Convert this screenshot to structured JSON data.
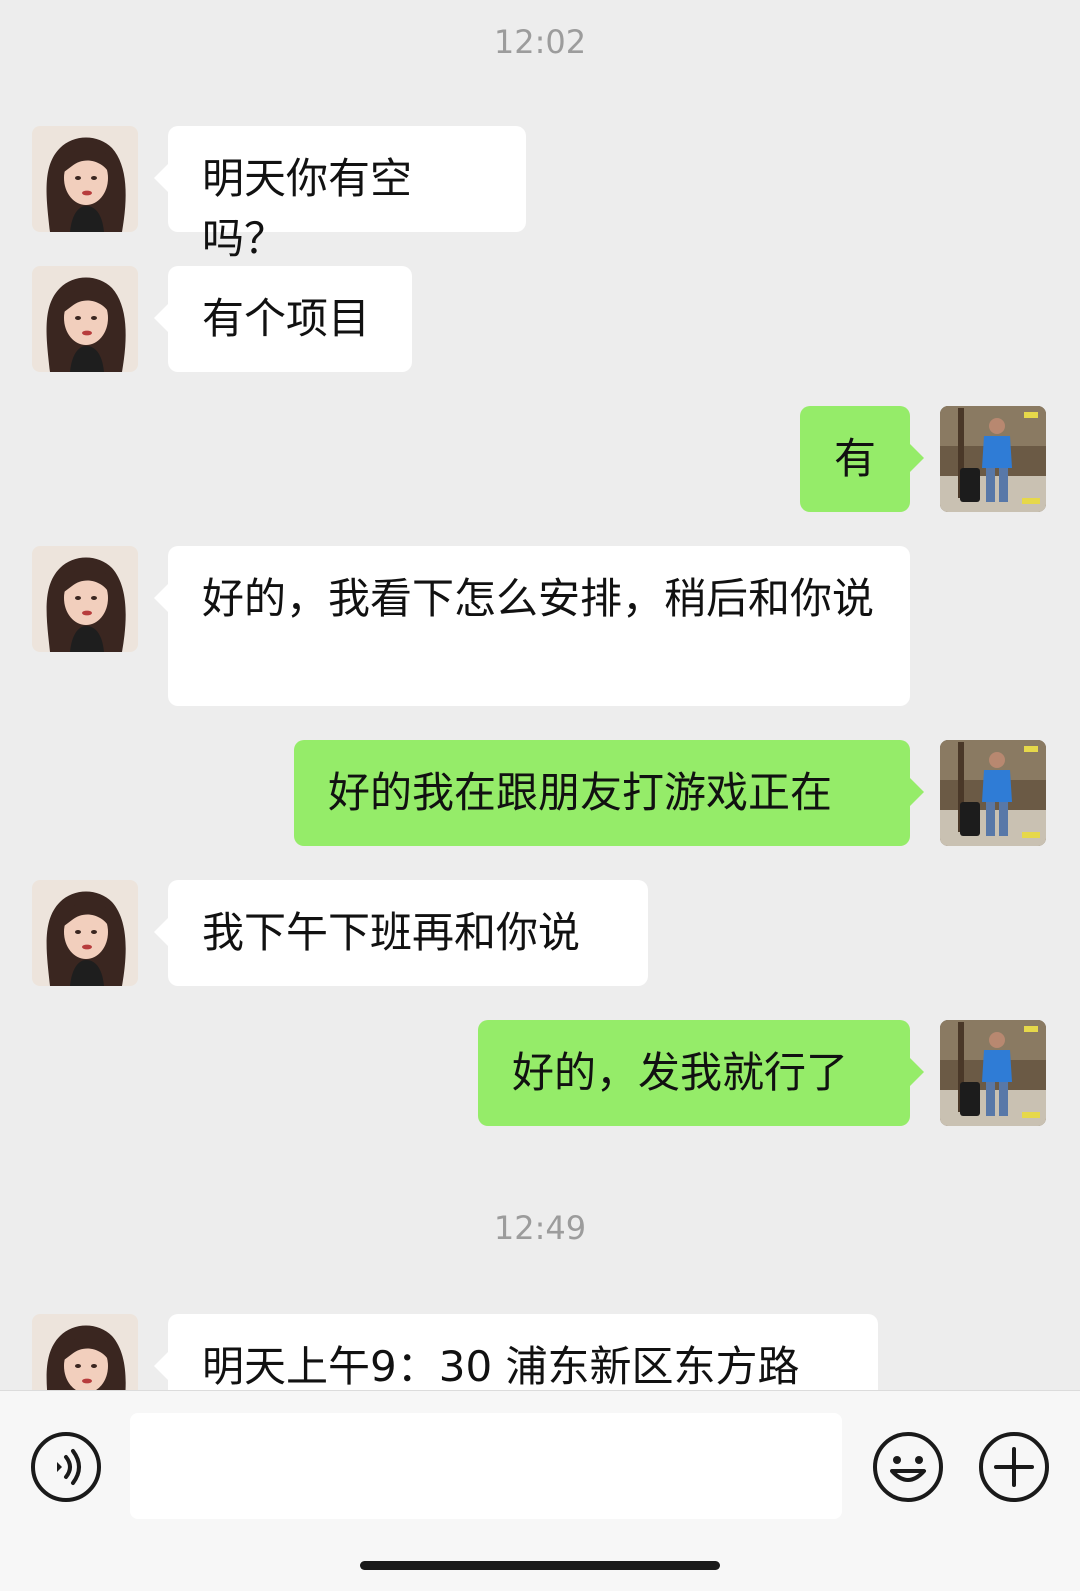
{
  "timestamps": [
    "12:02",
    "12:49"
  ],
  "messages": [
    {
      "side": "left",
      "text": "明天你有空吗？"
    },
    {
      "side": "left",
      "text": "有个项目"
    },
    {
      "side": "right",
      "text": "有"
    },
    {
      "side": "left",
      "text": "好的，我看下怎么安排，稍后和你说"
    },
    {
      "side": "right",
      "text": "好的我在跟朋友打游戏正在"
    },
    {
      "side": "left",
      "text": "我下午下班再和你说"
    },
    {
      "side": "right",
      "text": "好的，发我就行了"
    },
    {
      "side": "left",
      "text": "明天上午9：30 浦东新区东方路"
    }
  ],
  "input": {
    "placeholder": "",
    "value": ""
  },
  "icons": {
    "voice": "voice-icon",
    "emoji": "emoji-icon",
    "plus": "plus-icon"
  },
  "colors": {
    "background": "#ededed",
    "sent_bubble": "#95ec69",
    "received_bubble": "#ffffff",
    "timestamp": "#9c9c9c"
  }
}
